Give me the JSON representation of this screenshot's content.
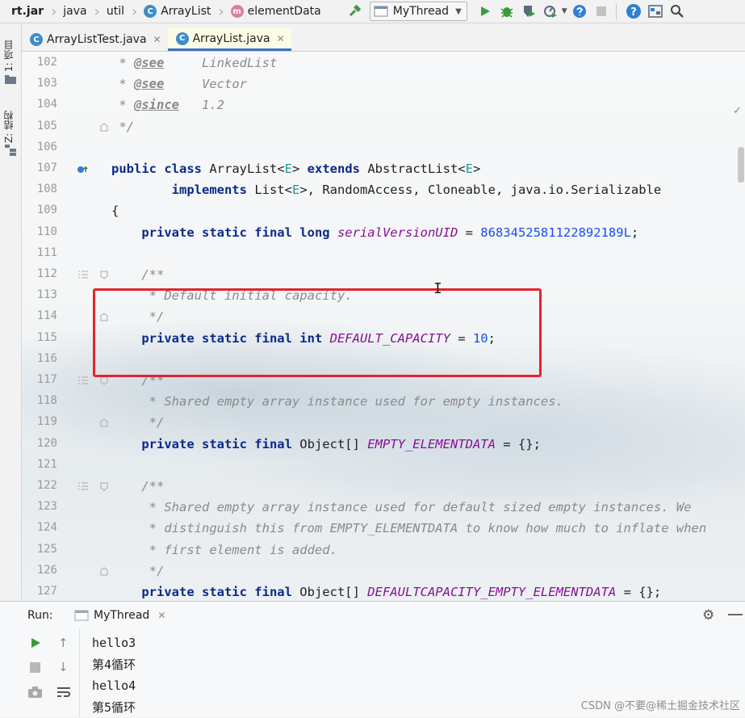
{
  "breadcrumb": [
    "rt.jar",
    "java",
    "util",
    "ArrayList",
    "elementData"
  ],
  "toolbar": {
    "run_config": "MyThread"
  },
  "side_tabs": {
    "project": "1: 项目",
    "structure": "Z: 结构"
  },
  "tabs": [
    {
      "label": "ArrayListTest.java",
      "active": false
    },
    {
      "label": "ArrayList.java",
      "active": true
    }
  ],
  "line_numbers": [
    "102",
    "103",
    "104",
    "105",
    "106",
    "107",
    "108",
    "109",
    "110",
    "111",
    "112",
    "113",
    "114",
    "115",
    "116",
    "117",
    "118",
    "119",
    "120",
    "121",
    "122",
    "123",
    "124",
    "125",
    "126",
    "127"
  ],
  "code_lines": [
    [
      {
        "t": " * ",
        "c": "cm"
      },
      {
        "t": "@see",
        "c": "tag"
      },
      {
        "t": "     LinkedList",
        "c": "cm"
      }
    ],
    [
      {
        "t": " * ",
        "c": "cm"
      },
      {
        "t": "@see",
        "c": "tag"
      },
      {
        "t": "     Vector",
        "c": "cm"
      }
    ],
    [
      {
        "t": " * ",
        "c": "cm"
      },
      {
        "t": "@since",
        "c": "tag"
      },
      {
        "t": "   1.2",
        "c": "cm"
      }
    ],
    [
      {
        "t": " */",
        "c": "cm"
      }
    ],
    [
      {
        "t": "",
        "c": ""
      }
    ],
    [
      {
        "t": "public class ",
        "c": "kw"
      },
      {
        "t": "ArrayList<",
        "c": ""
      },
      {
        "t": "E",
        "c": "gen"
      },
      {
        "t": "> ",
        "c": ""
      },
      {
        "t": "extends ",
        "c": "kw"
      },
      {
        "t": "AbstractList<",
        "c": ""
      },
      {
        "t": "E",
        "c": "gen"
      },
      {
        "t": ">",
        "c": ""
      }
    ],
    [
      {
        "t": "        implements ",
        "c": "kw"
      },
      {
        "t": "List<",
        "c": ""
      },
      {
        "t": "E",
        "c": "gen"
      },
      {
        "t": ">, RandomAccess, Cloneable, java.io.Serializable",
        "c": ""
      }
    ],
    [
      {
        "t": "{",
        "c": ""
      }
    ],
    [
      {
        "t": "    private static final long ",
        "c": "kw"
      },
      {
        "t": "serialVersionUID",
        "c": "fld"
      },
      {
        "t": " = ",
        "c": ""
      },
      {
        "t": "8683452581122892189L",
        "c": "num"
      },
      {
        "t": ";",
        "c": ""
      }
    ],
    [
      {
        "t": "",
        "c": ""
      }
    ],
    [
      {
        "t": "    /**",
        "c": "cm"
      }
    ],
    [
      {
        "t": "     * Default initial capacity.",
        "c": "cm"
      }
    ],
    [
      {
        "t": "     */",
        "c": "cm"
      }
    ],
    [
      {
        "t": "    private static final int ",
        "c": "kw"
      },
      {
        "t": "DEFAULT_CAPACITY",
        "c": "fld"
      },
      {
        "t": " = ",
        "c": ""
      },
      {
        "t": "10",
        "c": "num"
      },
      {
        "t": ";",
        "c": ""
      }
    ],
    [
      {
        "t": "",
        "c": ""
      }
    ],
    [
      {
        "t": "    /**",
        "c": "cm"
      }
    ],
    [
      {
        "t": "     * Shared empty array instance used for empty instances.",
        "c": "cm"
      }
    ],
    [
      {
        "t": "     */",
        "c": "cm"
      }
    ],
    [
      {
        "t": "    private static final ",
        "c": "kw"
      },
      {
        "t": "Object[] ",
        "c": ""
      },
      {
        "t": "EMPTY_ELEMENTDATA",
        "c": "fld"
      },
      {
        "t": " = {};",
        "c": ""
      }
    ],
    [
      {
        "t": "",
        "c": ""
      }
    ],
    [
      {
        "t": "    /**",
        "c": "cm"
      }
    ],
    [
      {
        "t": "     * Shared empty array instance used for default sized empty instances. We",
        "c": "cm"
      }
    ],
    [
      {
        "t": "     * distinguish this from EMPTY_ELEMENTDATA to know how much to inflate when",
        "c": "cm"
      }
    ],
    [
      {
        "t": "     * first element is added.",
        "c": "cm"
      }
    ],
    [
      {
        "t": "     */",
        "c": "cm"
      }
    ],
    [
      {
        "t": "    private static final ",
        "c": "kw"
      },
      {
        "t": "Object[] ",
        "c": ""
      },
      {
        "t": "DEFAULTCAPACITY_EMPTY_ELEMENTDATA",
        "c": "fld"
      },
      {
        "t": " = {};",
        "c": ""
      }
    ]
  ],
  "run_panel": {
    "label": "Run:",
    "tab": "MyThread",
    "output": [
      "hello3",
      "第4循环",
      "hello4",
      "第5循环"
    ]
  },
  "watermark": "CSDN @不要@稀土掘金技术社区"
}
